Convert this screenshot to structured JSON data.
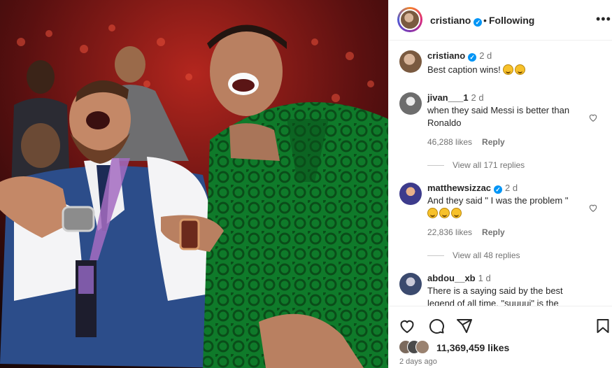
{
  "post": {
    "photo_alt": "",
    "author": "cristiano",
    "follow_status": "Following",
    "separator": "•",
    "more": "•••"
  },
  "comments": [
    {
      "user": "cristiano",
      "time": "2 d",
      "text": "Best caption wins!",
      "emojis": [
        "winking-face-emoji",
        "grinning-sweat-emoji"
      ],
      "verified": true,
      "likes": "",
      "reply": ""
    },
    {
      "user": "jivan___1",
      "time": "2 d",
      "text": "when they said Messi is better than Ronaldo",
      "emojis": [],
      "verified": false,
      "likes": "46,288 likes",
      "reply": "Reply",
      "view_replies": "View all 171 replies"
    },
    {
      "user": "matthewsizzac",
      "time": "2 d",
      "text": "And they said \" I was the problem \"",
      "emojis": [
        "rofl-emoji",
        "rofl-emoji",
        "rofl-emoji"
      ],
      "verified": true,
      "likes": "22,836 likes",
      "reply": "Reply",
      "view_replies": "View all 48 replies"
    },
    {
      "user": "abdou__xb",
      "time": "1 d",
      "text": "There is a saying said by the best legend of all time, \"suuuui\" is the",
      "emojis": [],
      "verified": false,
      "likes": "",
      "reply": ""
    }
  ],
  "footer": {
    "likes_count": "11,369,459 likes",
    "posted": "2 days ago"
  },
  "icons": [
    "heart-icon",
    "comment-icon",
    "share-icon",
    "bookmark-icon",
    "verified-badge-icon"
  ],
  "colors": {
    "accent": "#0095f6",
    "text": "#262626",
    "muted": "#737373"
  }
}
